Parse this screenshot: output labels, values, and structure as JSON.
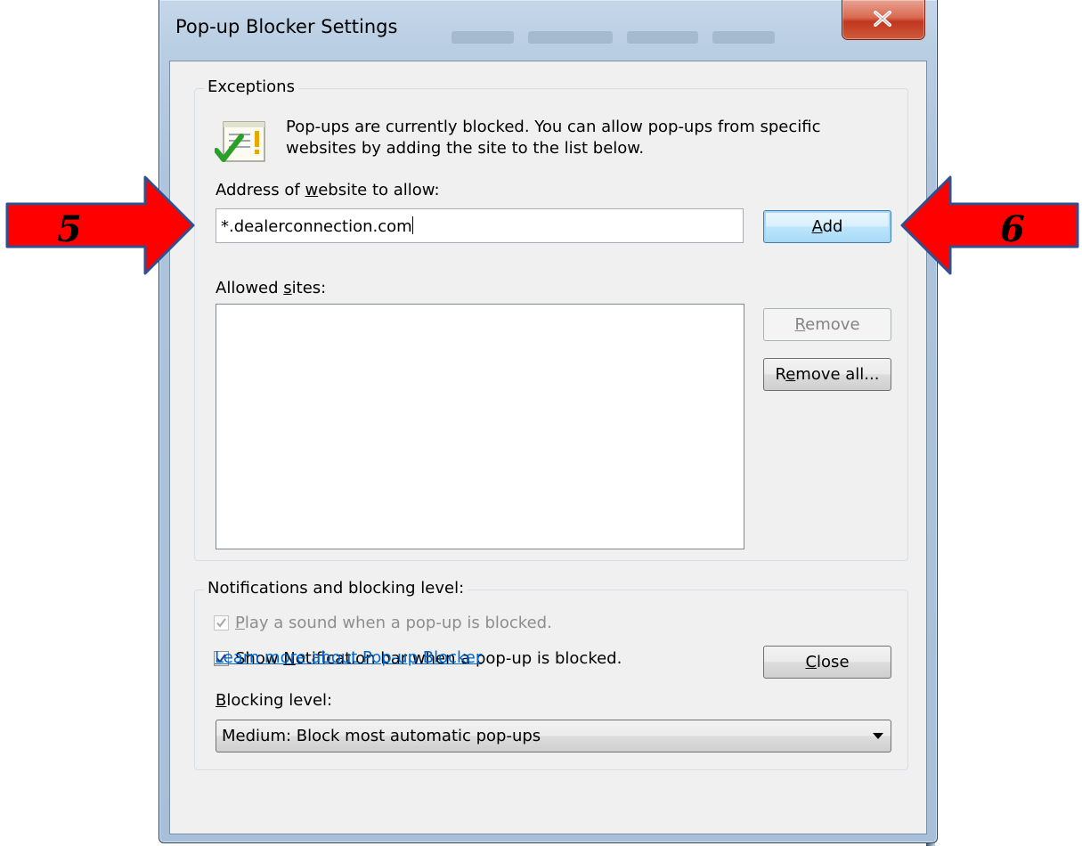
{
  "window": {
    "title": "Pop-up Blocker Settings",
    "close_glyph": "x"
  },
  "exceptions": {
    "legend": "Exceptions",
    "icon": "pop-up-list-check-icon",
    "info_line1": "Pop-ups are currently blocked.  You can allow pop-ups from specific",
    "info_line2": "websites by adding the site to the list below.",
    "address_label_pre": "Address of ",
    "address_label_key": "w",
    "address_label_post": "ebsite to allow:",
    "address_value": "*.dealerconnection.com",
    "add_button_key": "A",
    "add_button_rest": "dd",
    "allowed_label_pre": "Allowed ",
    "allowed_label_key": "s",
    "allowed_label_post": "ites:",
    "allowed_sites": [],
    "remove_button_key": "R",
    "remove_button_rest": "emove",
    "remove_all_pre": "R",
    "remove_all_key": "e",
    "remove_all_post": "move all..."
  },
  "notifications": {
    "legend": "Notifications and blocking level:",
    "play_sound_key": "P",
    "play_sound_rest": "lay a sound when a pop-up is blocked.",
    "play_sound_checked": true,
    "play_sound_enabled": false,
    "show_bar_pre": "Show ",
    "show_bar_key": "N",
    "show_bar_post": "otification bar when a pop-up is blocked.",
    "show_bar_checked": true,
    "blocking_label_key": "B",
    "blocking_label_rest": "locking level:",
    "blocking_value": "Medium: Block most automatic pop-ups"
  },
  "footer": {
    "learn_more_link": "Learn more about Pop-up Blocker",
    "close_button_key": "C",
    "close_button_rest": "lose"
  },
  "annotations": {
    "left_arrow_label": "5",
    "right_arrow_label": "6",
    "arrow_color": "#ff0000",
    "arrow_outline_color": "#2f4f8f"
  },
  "colors": {
    "link": "#0066cc",
    "dialog_bg": "#f0f0f0",
    "close_button_red": "#c0371f"
  }
}
